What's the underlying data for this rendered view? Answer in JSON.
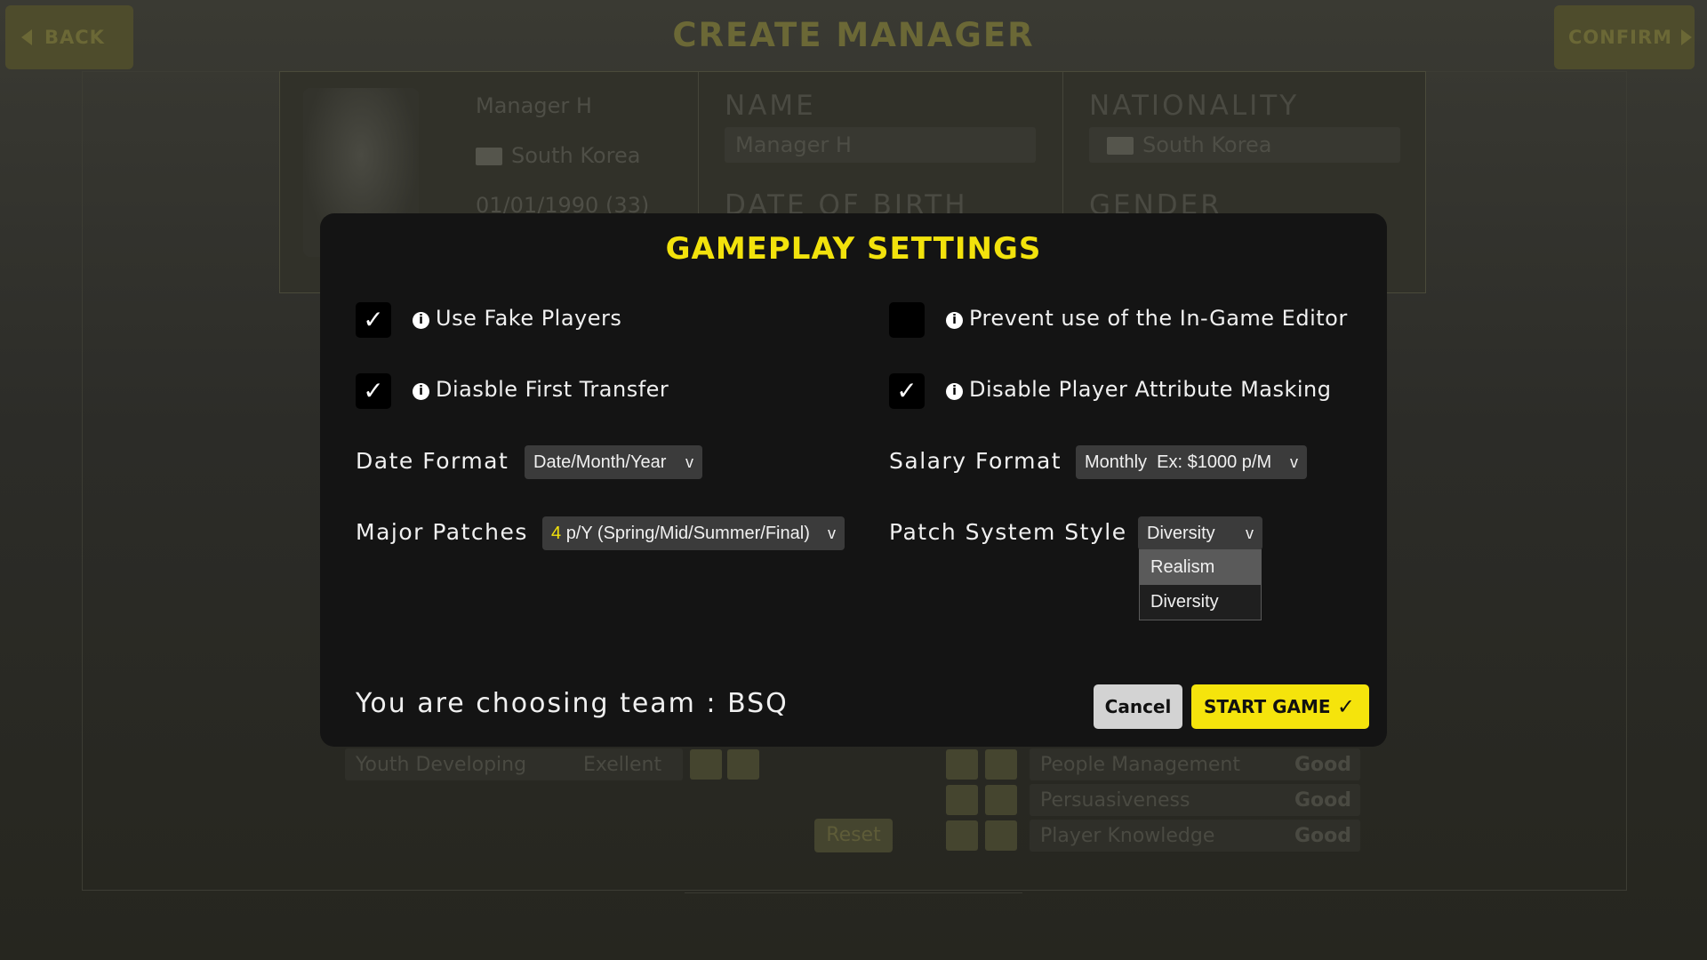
{
  "background": {
    "back_label": "BACK",
    "confirm_label": "CONFIRM",
    "title": "CREATE MANAGER",
    "profile": {
      "name": "Manager H",
      "nationality": "South Korea",
      "dob": "01/01/1990 (33)"
    },
    "fields": {
      "name_label": "NAME",
      "name_value": "Manager H",
      "nationality_label": "NATIONALITY",
      "nationality_value": "South Korea",
      "dob_label": "DATE OF BIRTH",
      "gender_label": "GENDER"
    },
    "attributes_left": [
      {
        "label": "Youth Developing",
        "value": "Exellent"
      }
    ],
    "attributes_right": [
      {
        "label": "People Management",
        "value": "Good"
      },
      {
        "label": "Persuasiveness",
        "value": "Good"
      },
      {
        "label": "Player Knowledge",
        "value": "Good"
      }
    ],
    "reset_label": "Reset"
  },
  "modal": {
    "title": "GAMEPLAY SETTINGS",
    "options": [
      {
        "label": "Use Fake Players",
        "checked": true
      },
      {
        "label": "Prevent use of the In-Game Editor",
        "checked": false
      },
      {
        "label": "Diasble First Transfer",
        "checked": true
      },
      {
        "label": "Disable Player Attribute Masking",
        "checked": true
      }
    ],
    "date_format": {
      "label": "Date Format",
      "value": "Date/Month/Year"
    },
    "salary_format": {
      "label": "Salary Format",
      "value": "Monthly  Ex: $1000 p/M"
    },
    "major_patches": {
      "label": "Major Patches",
      "count": "4",
      "value": "p/Y (Spring/Mid/Summer/Final)"
    },
    "patch_style": {
      "label": "Patch System Style",
      "value": "Diversity",
      "options": [
        "Realism",
        "Diversity"
      ]
    },
    "team_text": "You are choosing team : BSQ",
    "cancel_label": "Cancel",
    "start_label": "START GAME",
    "check_glyph": "✓",
    "chevron_glyph": "v",
    "info_glyph": "i"
  },
  "colors": {
    "accent": "#f2e20c",
    "panel": "#141414"
  }
}
